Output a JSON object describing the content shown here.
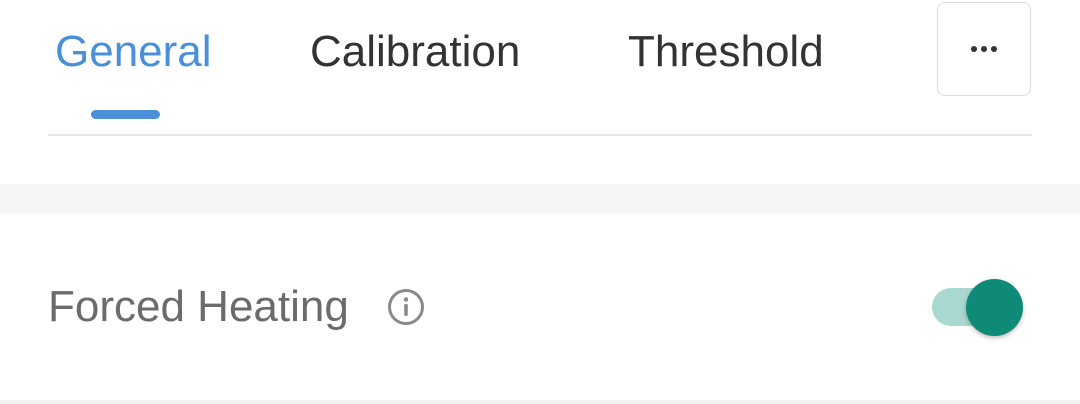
{
  "tabs": [
    {
      "label": "General",
      "active": true
    },
    {
      "label": "Calibration",
      "active": false
    },
    {
      "label": "Threshold",
      "active": false
    }
  ],
  "more_icon": "more-horizontal-icon",
  "setting": {
    "label": "Forced Heating",
    "info_icon": "info-icon",
    "enabled": true
  },
  "colors": {
    "accent_blue": "#4a90d9",
    "toggle_on": "#0f8a76",
    "toggle_track_on": "#a8d8cf"
  }
}
